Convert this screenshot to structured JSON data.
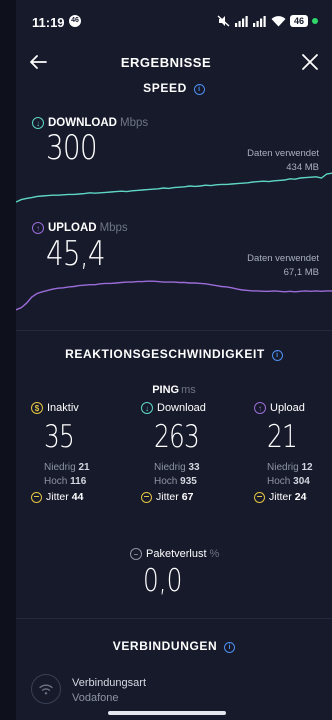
{
  "status_bar": {
    "time": "11:19",
    "notif_badge": "46",
    "battery": "46"
  },
  "header": {
    "title": "ERGEBNISSE"
  },
  "speed": {
    "title": "SPEED",
    "download": {
      "label": "DOWNLOAD",
      "unit": "Mbps",
      "value": "300",
      "used_label": "Daten verwendet",
      "used_value": "434 MB",
      "color": "#5fd6c4",
      "graph": [
        0.1,
        0.16,
        0.19,
        0.21,
        0.24,
        0.25,
        0.26,
        0.27,
        0.27,
        0.28,
        0.29,
        0.29,
        0.3,
        0.31,
        0.33,
        0.32,
        0.33,
        0.34,
        0.35,
        0.36,
        0.37,
        0.36,
        0.38,
        0.39,
        0.4,
        0.41,
        0.42,
        0.43,
        0.45,
        0.44,
        0.46,
        0.47,
        0.48,
        0.5,
        0.49,
        0.5,
        0.52,
        0.51,
        0.53,
        0.54,
        0.54,
        0.55,
        0.56,
        0.57,
        0.58,
        0.6,
        0.61,
        0.62,
        0.61,
        0.63,
        0.64,
        0.65,
        0.68,
        0.67,
        0.7,
        0.71,
        0.72,
        0.73,
        0.7,
        0.8,
        0.82
      ]
    },
    "upload": {
      "label": "UPLOAD",
      "unit": "Mbps",
      "value": "45,4",
      "used_label": "Daten verwendet",
      "used_value": "67,1 MB",
      "color": "#9b6cd8",
      "graph": [
        0.05,
        0.1,
        0.2,
        0.34,
        0.42,
        0.46,
        0.49,
        0.52,
        0.54,
        0.55,
        0.57,
        0.58,
        0.6,
        0.61,
        0.62,
        0.62,
        0.64,
        0.65,
        0.65,
        0.66,
        0.67,
        0.68,
        0.68,
        0.69,
        0.69,
        0.7,
        0.7,
        0.69,
        0.68,
        0.68,
        0.68,
        0.67,
        0.67,
        0.66,
        0.66,
        0.65,
        0.64,
        0.62,
        0.6,
        0.58,
        0.57,
        0.55,
        0.52,
        0.5,
        0.49,
        0.48,
        0.48,
        0.47,
        0.47,
        0.48,
        0.47,
        0.46,
        0.47,
        0.46,
        0.47,
        0.48,
        0.47,
        0.48,
        0.47,
        0.48,
        0.48
      ]
    }
  },
  "reaction": {
    "title": "REAKTIONSGESCHWINDIGKEIT",
    "ping_label": "PING",
    "ping_unit": "ms",
    "columns": [
      {
        "label": "Inaktiv",
        "value": "35",
        "low_label": "Niedrig",
        "low": "21",
        "high_label": "Hoch",
        "high": "116",
        "jitter_label": "Jitter",
        "jitter": "44",
        "icon_color": "#e3c341"
      },
      {
        "label": "Download",
        "value": "263",
        "low_label": "Niedrig",
        "low": "33",
        "high_label": "Hoch",
        "high": "935",
        "jitter_label": "Jitter",
        "jitter": "67",
        "icon_color": "#5fd6c4"
      },
      {
        "label": "Upload",
        "value": "21",
        "low_label": "Niedrig",
        "low": "12",
        "high_label": "Hoch",
        "high": "304",
        "jitter_label": "Jitter",
        "jitter": "24",
        "icon_color": "#9b6cd8"
      }
    ],
    "packet_loss": {
      "label": "Paketverlust",
      "unit": "%",
      "value": "0,0"
    }
  },
  "connections": {
    "title": "VERBINDUNGEN",
    "type_label": "Verbindungsart",
    "type_value": "Vodafone"
  }
}
